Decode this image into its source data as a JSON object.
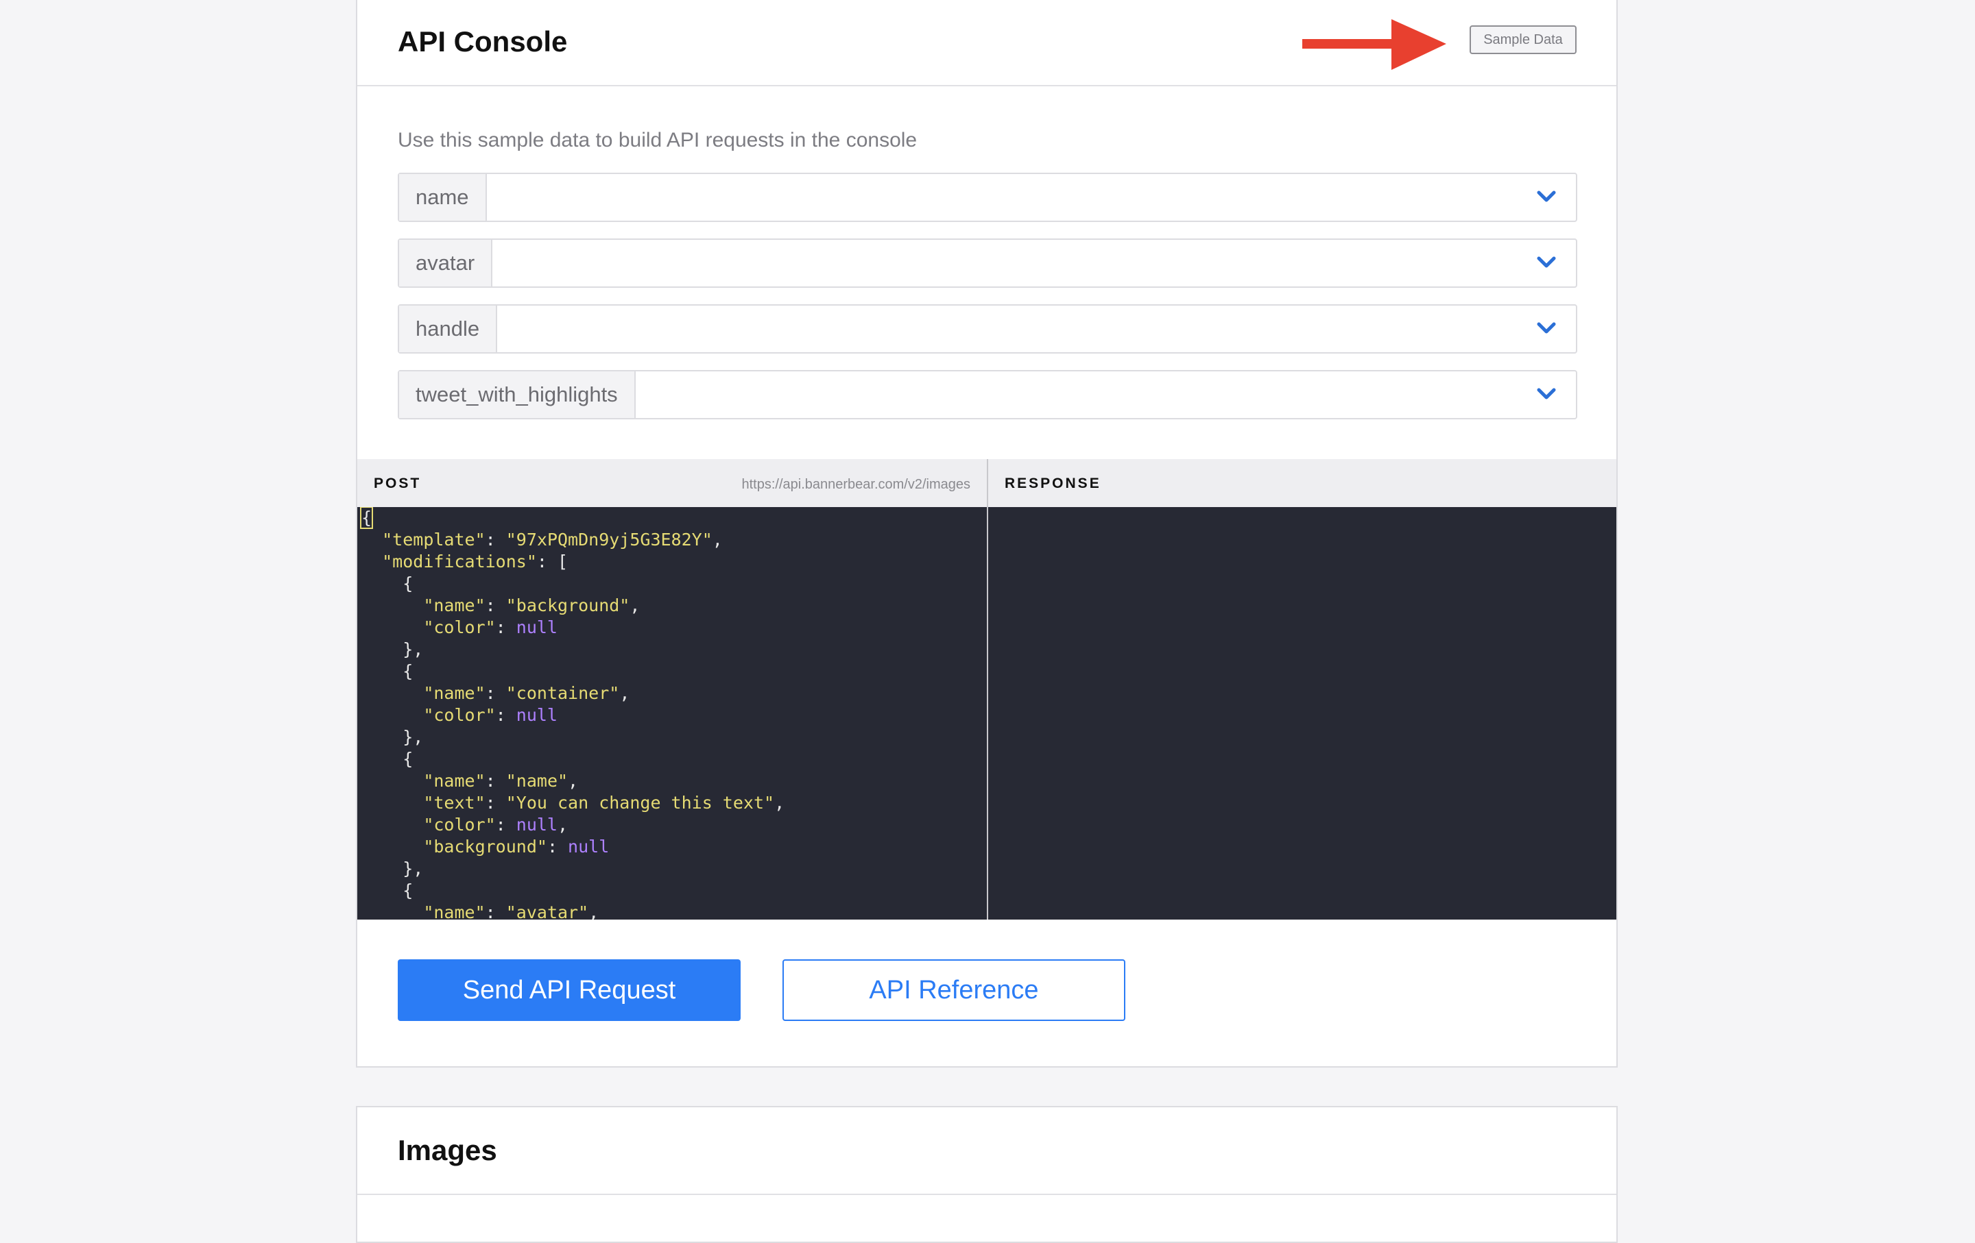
{
  "console": {
    "title": "API Console",
    "sample_data_label": "Sample Data",
    "instructions": "Use this sample data to build API requests in the console",
    "fields": [
      {
        "label": "name",
        "value": ""
      },
      {
        "label": "avatar",
        "value": ""
      },
      {
        "label": "handle",
        "value": ""
      },
      {
        "label": "tweet_with_highlights",
        "value": ""
      }
    ],
    "post": {
      "method": "POST",
      "url": "https://api.bannerbear.com/v2/images",
      "code_lines": [
        [
          [
            "p",
            "{"
          ]
        ],
        [
          [
            "p",
            "  "
          ],
          [
            "k",
            "\"template\""
          ],
          [
            "p",
            ": "
          ],
          [
            "s",
            "\"97xPQmDn9yj5G3E82Y\""
          ],
          [
            "p",
            ","
          ]
        ],
        [
          [
            "p",
            "  "
          ],
          [
            "k",
            "\"modifications\""
          ],
          [
            "p",
            ": ["
          ]
        ],
        [
          [
            "p",
            "    {"
          ]
        ],
        [
          [
            "p",
            "      "
          ],
          [
            "k",
            "\"name\""
          ],
          [
            "p",
            ": "
          ],
          [
            "s",
            "\"background\""
          ],
          [
            "p",
            ","
          ]
        ],
        [
          [
            "p",
            "      "
          ],
          [
            "k",
            "\"color\""
          ],
          [
            "p",
            ": "
          ],
          [
            "n",
            "null"
          ]
        ],
        [
          [
            "p",
            "    },"
          ]
        ],
        [
          [
            "p",
            "    {"
          ]
        ],
        [
          [
            "p",
            "      "
          ],
          [
            "k",
            "\"name\""
          ],
          [
            "p",
            ": "
          ],
          [
            "s",
            "\"container\""
          ],
          [
            "p",
            ","
          ]
        ],
        [
          [
            "p",
            "      "
          ],
          [
            "k",
            "\"color\""
          ],
          [
            "p",
            ": "
          ],
          [
            "n",
            "null"
          ]
        ],
        [
          [
            "p",
            "    },"
          ]
        ],
        [
          [
            "p",
            "    {"
          ]
        ],
        [
          [
            "p",
            "      "
          ],
          [
            "k",
            "\"name\""
          ],
          [
            "p",
            ": "
          ],
          [
            "s",
            "\"name\""
          ],
          [
            "p",
            ","
          ]
        ],
        [
          [
            "p",
            "      "
          ],
          [
            "k",
            "\"text\""
          ],
          [
            "p",
            ": "
          ],
          [
            "s",
            "\"You can change this text\""
          ],
          [
            "p",
            ","
          ]
        ],
        [
          [
            "p",
            "      "
          ],
          [
            "k",
            "\"color\""
          ],
          [
            "p",
            ": "
          ],
          [
            "n",
            "null"
          ],
          [
            "p",
            ","
          ]
        ],
        [
          [
            "p",
            "      "
          ],
          [
            "k",
            "\"background\""
          ],
          [
            "p",
            ": "
          ],
          [
            "n",
            "null"
          ]
        ],
        [
          [
            "p",
            "    },"
          ]
        ],
        [
          [
            "p",
            "    {"
          ]
        ],
        [
          [
            "p",
            "      "
          ],
          [
            "k",
            "\"name\""
          ],
          [
            "p",
            ": "
          ],
          [
            "s",
            "\"avatar\""
          ],
          [
            "p",
            ","
          ]
        ]
      ]
    },
    "response": {
      "label": "RESPONSE",
      "body": ""
    },
    "buttons": {
      "send": "Send API Request",
      "reference": "API Reference"
    }
  },
  "images_section": {
    "title": "Images"
  },
  "colors": {
    "accent": "#2b7cf5",
    "annotation_arrow": "#e8402f",
    "code_background": "#272934",
    "code_string": "#e6db74",
    "code_null": "#ae81ff"
  },
  "icons": {
    "annotation": "arrow-right-icon",
    "dropdown": "chevron-down-icon"
  }
}
